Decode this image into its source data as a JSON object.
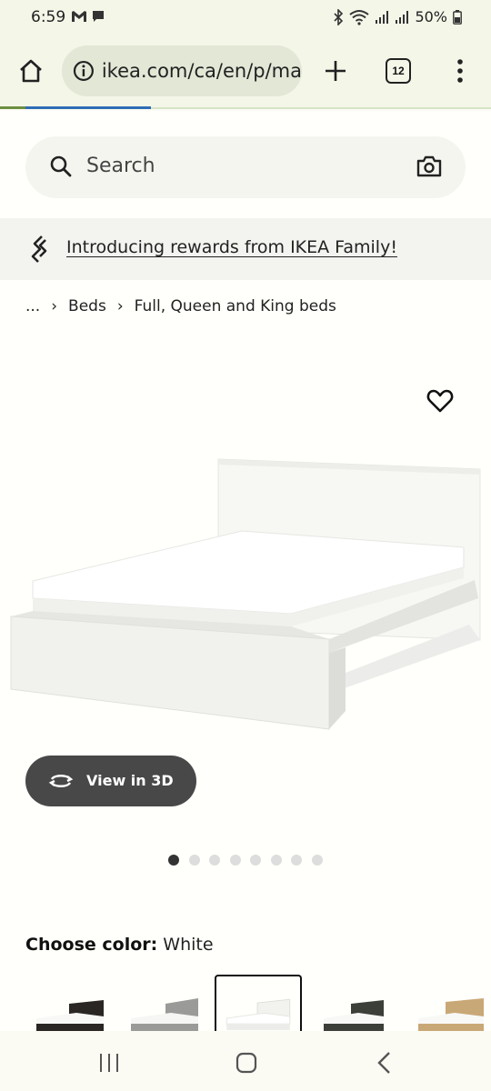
{
  "status_bar": {
    "time": "6:59",
    "battery": "50%"
  },
  "browser": {
    "url": "ikea.com/ca/en/p/ma",
    "tab_count": "12"
  },
  "search": {
    "placeholder": "Search"
  },
  "banner": {
    "link_text": "Introducing rewards from IKEA Family!"
  },
  "breadcrumb": {
    "ellipsis": "...",
    "items": [
      "Beds",
      "Full, Queen and King beds"
    ]
  },
  "product": {
    "view3d_label": "View in 3D",
    "carousel_total": 8,
    "carousel_active": 1,
    "color_label": "Choose color:",
    "color_value": "White",
    "swatches": [
      "black-brown",
      "gray",
      "white",
      "dark-gray",
      "oak"
    ],
    "selected_swatch": "white"
  },
  "colors": {
    "accent_green": "#6c8f3f",
    "progress_blue": "#2f6db5",
    "button_dark": "#484848"
  }
}
